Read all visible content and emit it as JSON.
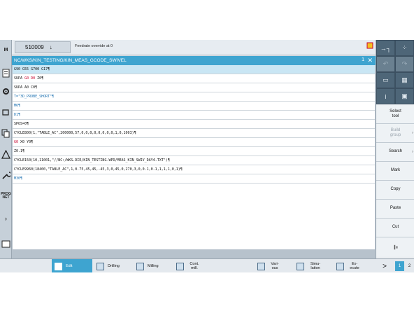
{
  "header": {
    "program_number": "510009",
    "program_arrow": "↓",
    "status_message": "Feedrate override at 0"
  },
  "editor": {
    "path": "NC/WKS/KIN_TESTING/KIN_MEAS_GCODE_SWIVEL",
    "window_number": "1",
    "close_symbol": "✕",
    "lines": [
      "G90 G55 G700 G17¶",
      "SUPA G0 D0 Z0¶",
      "SUPA A0 C0¶",
      "T=\"3D_PROBE_SHORT\"¶",
      "M6¶",
      "D1¶",
      "SPOS=0¶",
      "CYCLE800(1,\"TABLE_AC\",200000,57,0,0,0,0,0,0,0,0,1,0,1003)¶",
      "G0 X0 Y0¶",
      "Z0.1¶",
      "CYCLE150(10,11001,\"//NC:/WKS.DIR/KIN_TESTING.WPD/MEAS_KIN_SWIV_DAY4.TXT\")¶",
      "CYCLE9960(18400,\"TABLE_AC\",1,0.75,45,45,-45,3,0,45,0,270,3,0,0.1,0.1,1,1,1,0,1)¶",
      "M30¶"
    ]
  },
  "left_toolbar": {
    "items": [
      "M",
      "",
      "",
      "",
      "",
      "",
      "",
      "",
      "",
      "PROG NET",
      "›",
      "",
      ""
    ]
  },
  "right_softkeys": {
    "top_icons": [
      "→┐",
      "⁘",
      "↶",
      "↷",
      "▭",
      "▦",
      "i",
      "▣"
    ],
    "select_tool": "Select tool",
    "build_group": "Build group",
    "search": "Search",
    "mark": "Mark",
    "copy": "Copy",
    "paste": "Paste",
    "cut": "Cut"
  },
  "bottom_softkeys": {
    "edit": "Edit",
    "drilling": "Drilling",
    "milling": "Milling",
    "cont_mill": "Cont. mill.",
    "various": "Vari- ous",
    "simulation": "Simu- lation",
    "execute": "Ex- ecute",
    "more_arrow": ">",
    "page1": "1",
    "page2": "2"
  },
  "colors": {
    "accent": "#3ea4d0",
    "keyword": "#1a6fb0",
    "highlight_red": "#c8002c"
  }
}
